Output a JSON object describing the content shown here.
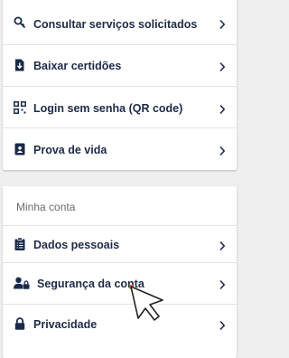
{
  "services": {
    "items": [
      {
        "label": "Consultar serviços solicitados",
        "icon": "search-key-icon"
      },
      {
        "label": "Baixar certidões",
        "icon": "document-download-icon"
      },
      {
        "label": "Login sem senha (QR code)",
        "icon": "qr-code-icon"
      },
      {
        "label": "Prova de vida",
        "icon": "id-badge-icon"
      }
    ]
  },
  "account": {
    "title": "Minha conta",
    "items": [
      {
        "label": "Dados pessoais",
        "icon": "clipboard-list-icon"
      },
      {
        "label": "Segurança da conta",
        "icon": "user-lock-icon"
      },
      {
        "label": "Privacidade",
        "icon": "padlock-icon"
      }
    ]
  },
  "colors": {
    "text": "#1d2a47",
    "background": "#efefef",
    "accent": "#e8602c"
  }
}
